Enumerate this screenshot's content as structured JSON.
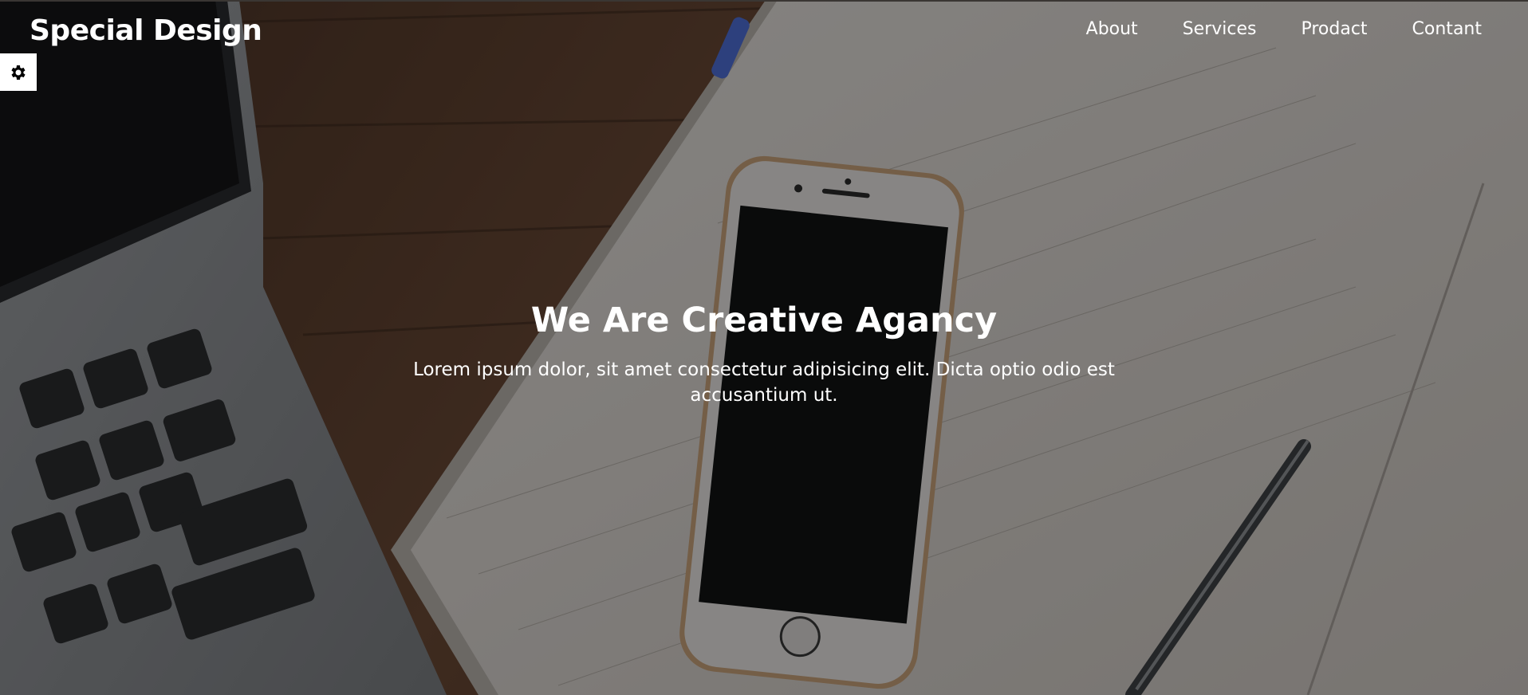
{
  "header": {
    "logo": "Special Design",
    "nav": [
      {
        "label": "About"
      },
      {
        "label": "Services"
      },
      {
        "label": "Prodact"
      },
      {
        "label": "Contant"
      }
    ]
  },
  "settings": {
    "icon": "gear-icon"
  },
  "hero": {
    "title": "We Are Creative Agancy",
    "description": "Lorem ipsum dolor, sit amet consectetur adipisicing elit. Dicta optio odio est accusantium ut.",
    "background": "desk-with-laptop-phone-notebook-pen"
  },
  "colors": {
    "overlay": "#000000",
    "text": "#ffffff",
    "gear_bg": "#ffffff",
    "wood": "#5b3f2e",
    "paper": "#d9d4cf"
  }
}
